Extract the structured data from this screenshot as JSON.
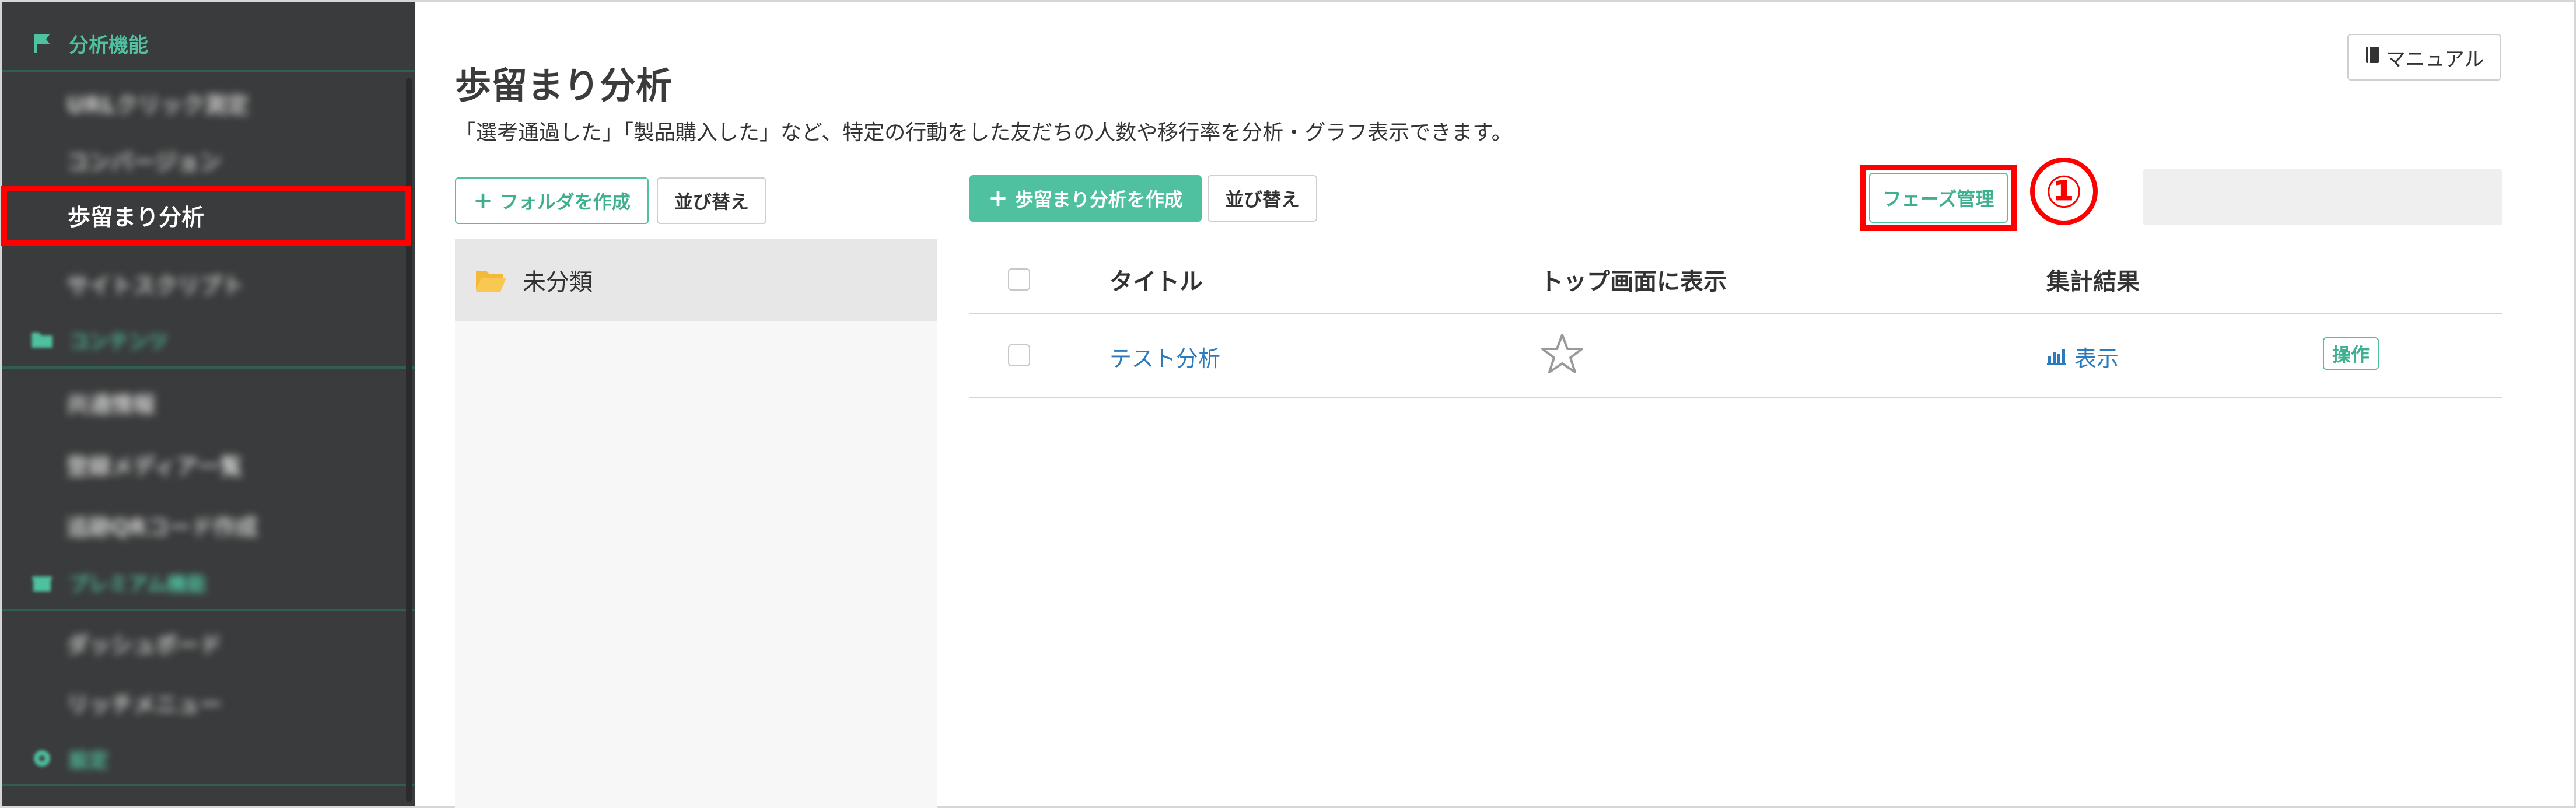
{
  "sidebar": {
    "section_analysis": "分析機能",
    "items_analysis": [
      "URLクリック測定",
      "コンバージョン",
      "歩留まり分析",
      "サイトスクリプト"
    ],
    "active_item": "歩留まり分析",
    "section_content": "コンテンツ",
    "items_content": [
      "共通情報",
      "登録メディア一覧",
      "追跡QRコード作成"
    ],
    "section_premium": "プレミアム機能",
    "items_premium": [
      "ダッシュボード",
      "リッチメニュー"
    ],
    "section_settings": "設定"
  },
  "header": {
    "title": "歩留まり分析",
    "description": "「選考通過した」「製品購入した」など、特定の行動をした友だちの人数や移行率を分析・グラフ表示できます。",
    "manual_label": "マニュアル"
  },
  "folders": {
    "create_label": "フォルダを作成",
    "sort_label": "並び替え",
    "items": [
      "未分類"
    ]
  },
  "toolbar": {
    "create_label": "歩留まり分析を作成",
    "sort_label": "並び替え",
    "phase_label": "フェーズ管理",
    "annotation": "①"
  },
  "table": {
    "columns": [
      "タイトル",
      "トップ画面に表示",
      "集計結果"
    ],
    "rows": [
      {
        "title": "テスト分析",
        "result_label": "表示",
        "action_label": "操作"
      }
    ]
  },
  "colors": {
    "accent": "#4fc1a0",
    "sidebar_bg": "#3a3b3c",
    "highlight": "#ff0000",
    "link": "#2d7bbd"
  }
}
